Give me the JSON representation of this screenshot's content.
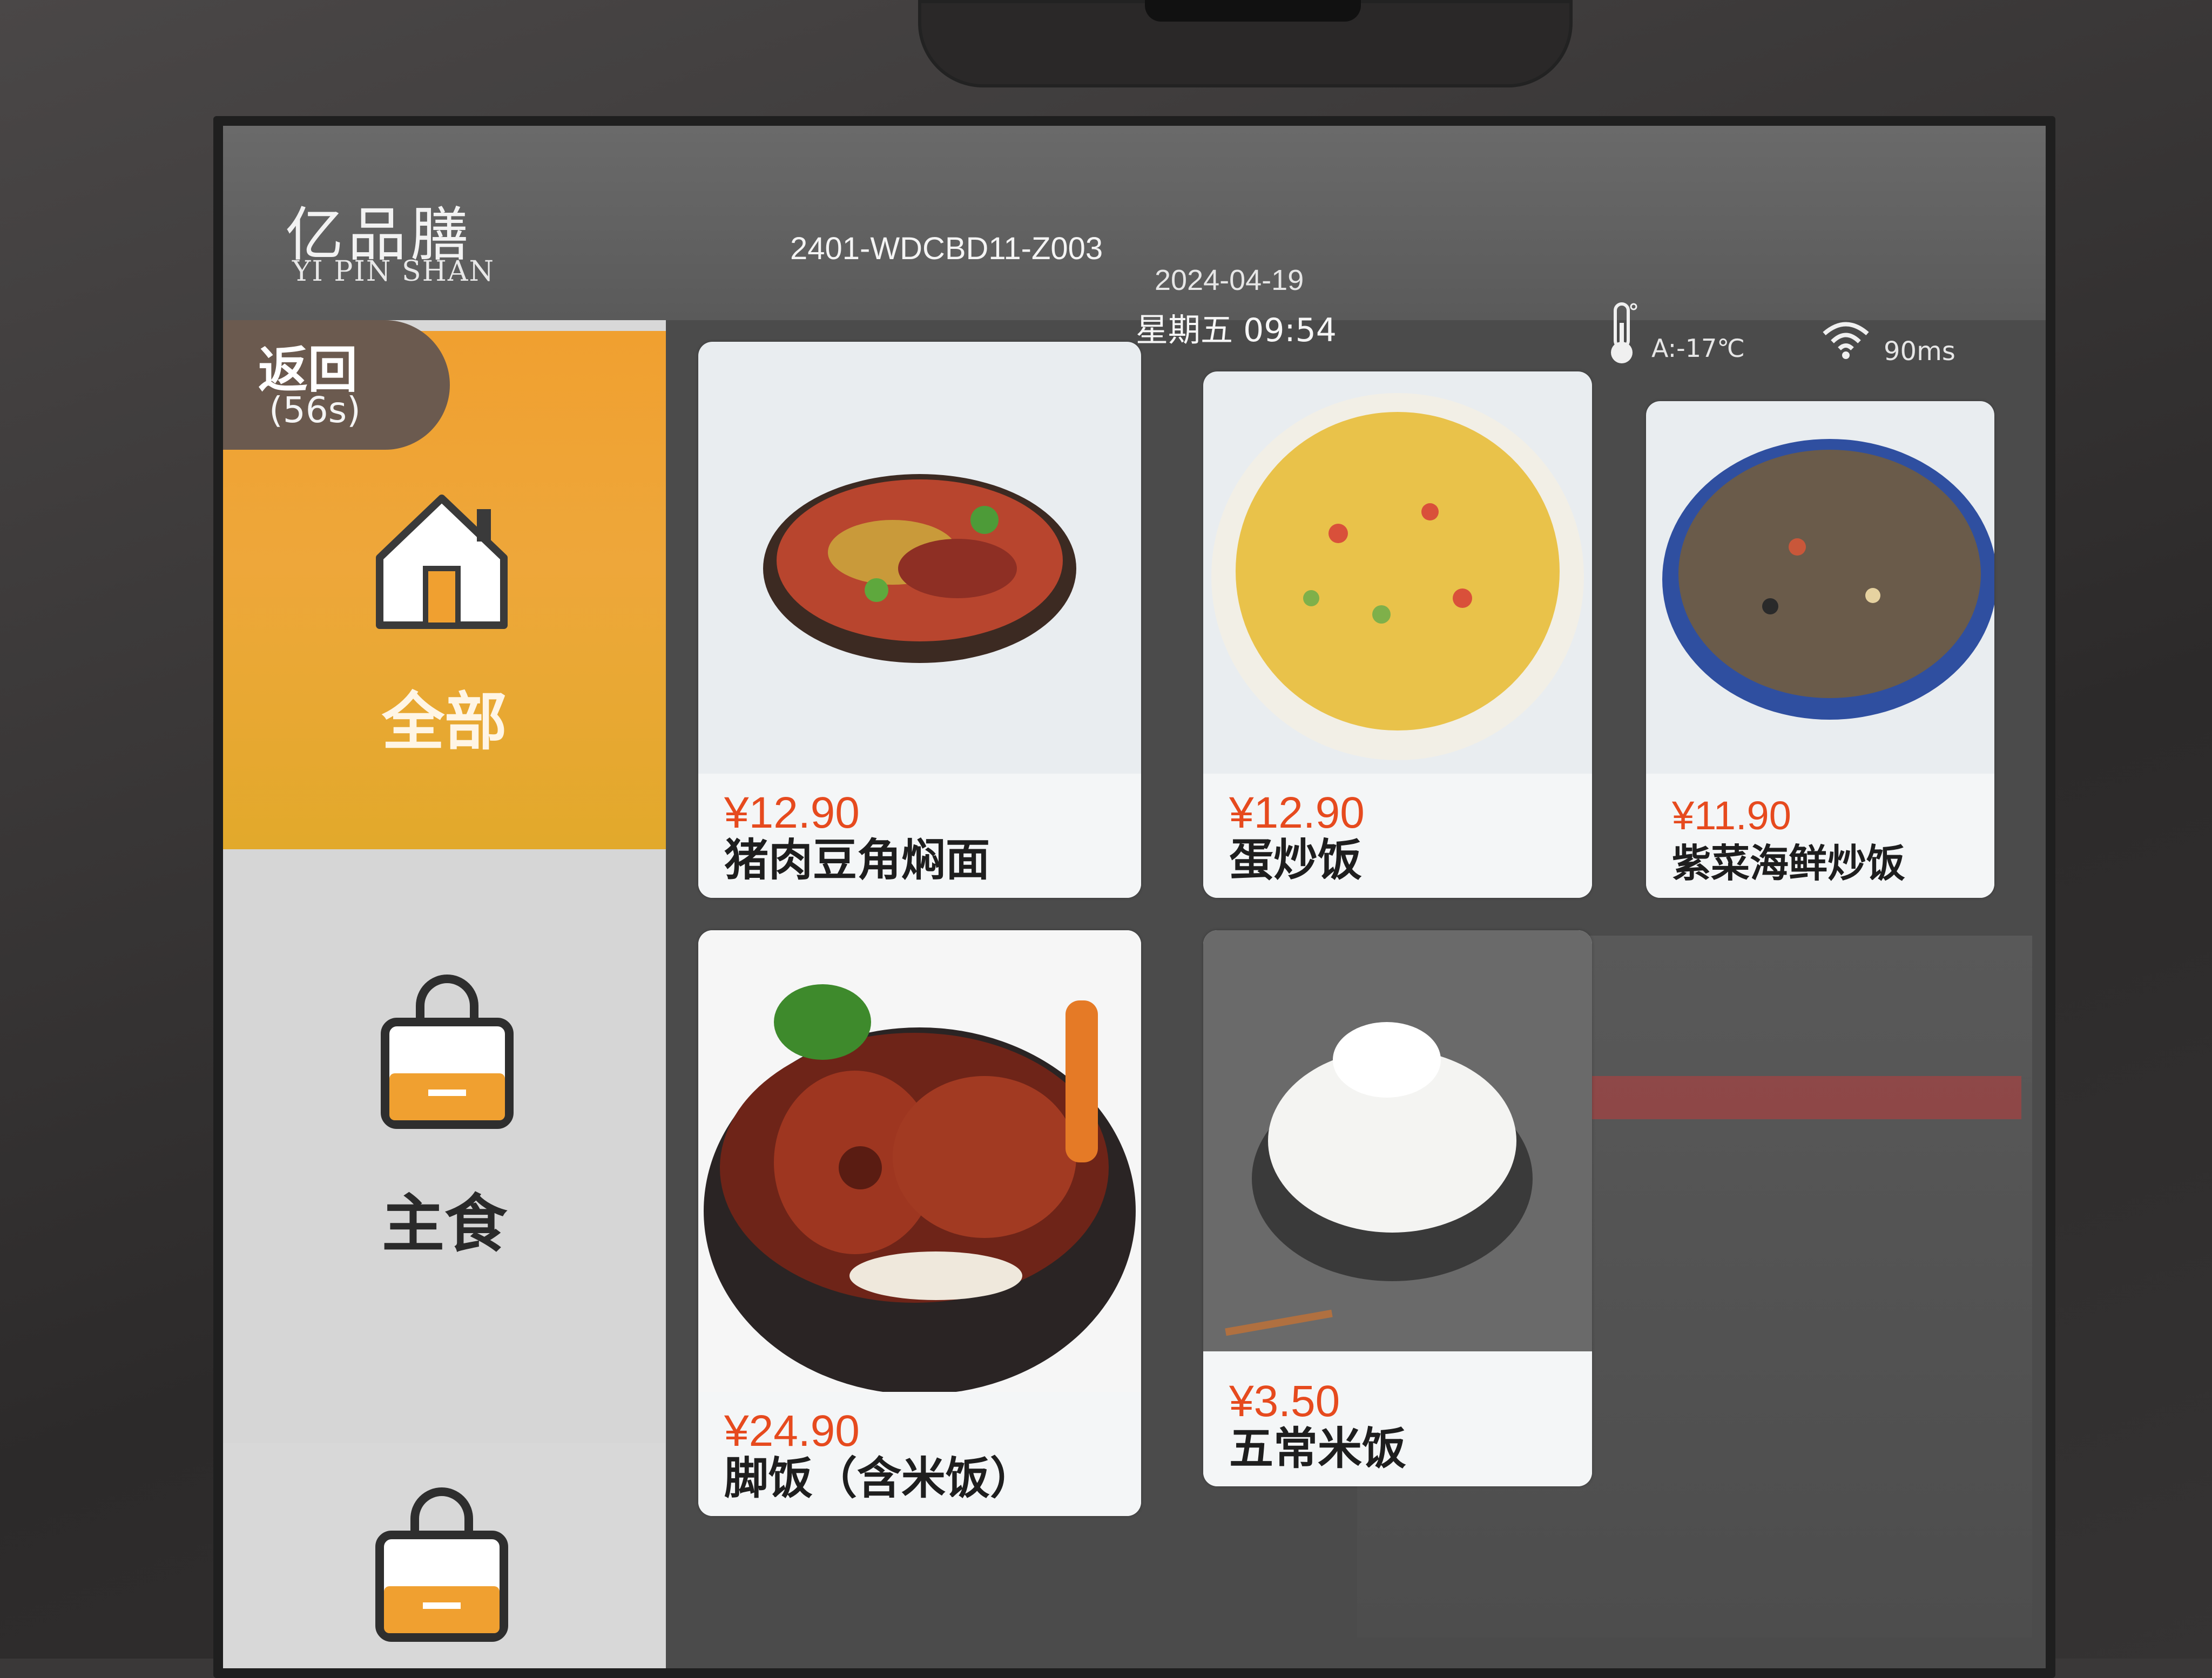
{
  "header": {
    "logo_cn": "亿品膳",
    "logo_en": "YI PIN SHAN",
    "device_id": "2401-WDCBD11-Z003",
    "date": "2024-04-19",
    "weekday_time": "星期五 09:54",
    "temperature": "A:-17℃",
    "latency": "90ms",
    "icons": {
      "temperature": "thermometer-icon",
      "network": "wifi-icon"
    }
  },
  "sidebar": {
    "back": {
      "label": "返回",
      "countdown": "(56s)"
    },
    "categories": [
      {
        "label": "全部",
        "icon": "home-icon",
        "active": true
      },
      {
        "label": "主食",
        "icon": "shopping-bag-icon",
        "active": false
      },
      {
        "label": "",
        "icon": "shopping-bag-icon",
        "active": false
      }
    ]
  },
  "menu": {
    "items": [
      {
        "price": "¥12.90",
        "name": "猪肉豆角焖面"
      },
      {
        "price": "¥12.90",
        "name": "蛋炒饭"
      },
      {
        "price": "¥11.90",
        "name": "紫菜海鲜炒饭"
      },
      {
        "price": "¥24.90",
        "name": "脚饭（含米饭）"
      },
      {
        "price": "¥3.50",
        "name": "五常米饭"
      }
    ]
  },
  "colors": {
    "accent_orange": "#f0a030",
    "price_red": "#e64a1e",
    "back_button": "#6b5a4f"
  }
}
